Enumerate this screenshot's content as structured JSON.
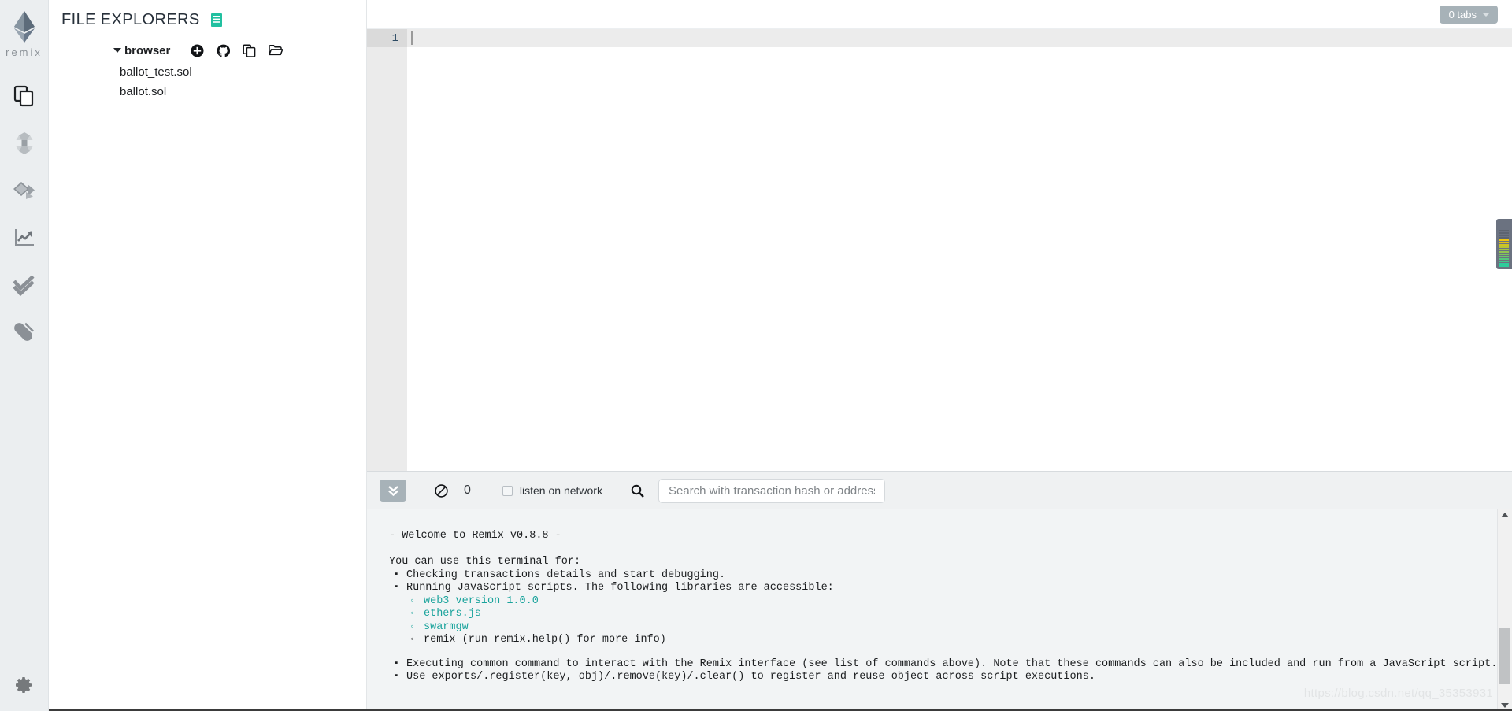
{
  "app": {
    "name": "Remix",
    "logo_text": "remix",
    "accent": "#21c0a0",
    "panel_bg": "#ebeef0",
    "terminal_bg": "#f2f4f5",
    "pill_bg": "#a7b2b8"
  },
  "iconbar": {
    "items": [
      {
        "name": "file-explorers-icon",
        "title": "File explorers"
      },
      {
        "name": "solidity-compiler-icon",
        "title": "Solidity compiler"
      },
      {
        "name": "deploy-run-transactions-icon",
        "title": "Deploy & run transactions"
      },
      {
        "name": "analysis-icon",
        "title": "Solidity static analysis"
      },
      {
        "name": "testing-icon",
        "title": "Solidity unit testing"
      },
      {
        "name": "plugin-manager-icon",
        "title": "Plugin manager"
      }
    ],
    "settings": {
      "name": "settings-icon",
      "title": "Settings"
    }
  },
  "sidepanel": {
    "title": "FILE EXPLORERS",
    "badge_icon": "book-icon",
    "root": {
      "label": "browser",
      "expanded": true,
      "actions": [
        {
          "name": "create-new-file-icon",
          "title": "Create New File"
        },
        {
          "name": "github-icon",
          "title": "Import from GitHub"
        },
        {
          "name": "copy-files-icon",
          "title": "Copy Files"
        },
        {
          "name": "open-folder-icon",
          "title": "Open Local Folder"
        }
      ],
      "files": [
        {
          "name": "ballot_test.sol"
        },
        {
          "name": "ballot.sol"
        }
      ]
    }
  },
  "tabbar": {
    "tabs_label": "0 tabs"
  },
  "editor": {
    "lines": [
      {
        "number": "1",
        "text": ""
      }
    ],
    "active_line": "1"
  },
  "terminal": {
    "toolbar": {
      "toggle_icon": "chevron-double-down-icon",
      "clear_icon": "ban-icon",
      "pending_count": "0",
      "listen_label": "listen on network",
      "listen_checked": false,
      "search_icon": "search-icon",
      "search_value": "",
      "search_placeholder": "Search with transaction hash or address"
    },
    "log": {
      "welcome": "- Welcome to Remix v0.8.8 -",
      "intro": "You can use this terminal for:",
      "bullets": [
        "Checking transactions details and start debugging.",
        "Running JavaScript scripts. The following libraries are accessible:"
      ],
      "libraries": [
        {
          "text": "web3 version 1.0.0",
          "highlight": true
        },
        {
          "text": "ethers.js",
          "highlight": true
        },
        {
          "text": "swarmgw",
          "highlight": true
        },
        {
          "text": "remix (run remix.help() for more info)",
          "highlight": false
        }
      ],
      "bullets_tail": [
        "Executing common command to interact with the Remix interface (see list of commands above). Note that these commands can also be included and run from a JavaScript script.",
        "Use exports/.register(key, obj)/.remove(key)/.clear() to register and reuse object across script executions."
      ]
    }
  },
  "overlay": {
    "level_meter_name": "level-meter-widget",
    "meter_colors": [
      "#2ecc9b",
      "#2ecc9b",
      "#42c98b",
      "#55c87c",
      "#69c76d",
      "#7dc65e",
      "#92c550",
      "#a6c441",
      "#bac333",
      "#cfc224",
      "#e3c116",
      "#efc40f",
      "#5c6470",
      "#5c6470",
      "#5c6470",
      "#5c6470"
    ]
  },
  "watermark": {
    "text": "https://blog.csdn.net/qq_35353931"
  }
}
